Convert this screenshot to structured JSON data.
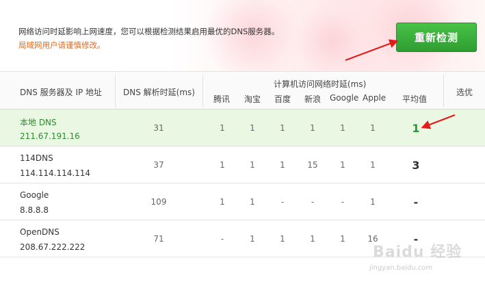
{
  "notice": {
    "text": "网络访问时延影响上网速度，您可以根据检测结果启用最优的DNS服务器。",
    "warning": "局域网用户请谨慎修改。"
  },
  "recheck_button": "重新检测",
  "table": {
    "col_server": "DNS 服务器及 IP 地址",
    "col_resolve": "DNS 解析时延(ms)",
    "col_group": "计算机访问网络时延(ms)",
    "sites": [
      "腾讯",
      "淘宝",
      "百度",
      "新浪",
      "Google",
      "Apple"
    ],
    "col_avg": "平均值",
    "col_choose": "选优",
    "rows": [
      {
        "name": "本地 DNS",
        "ip": "211.67.191.16",
        "resolve": "31",
        "sites": [
          "1",
          "1",
          "1",
          "1",
          "1",
          "1"
        ],
        "avg": "1"
      },
      {
        "name": "114DNS",
        "ip": "114.114.114.114",
        "resolve": "37",
        "sites": [
          "1",
          "1",
          "1",
          "15",
          "1",
          "1"
        ],
        "avg": "3"
      },
      {
        "name": "Google",
        "ip": "8.8.8.8",
        "resolve": "109",
        "sites": [
          "1",
          "1",
          "-",
          "-",
          "-",
          "1"
        ],
        "avg": "-"
      },
      {
        "name": "OpenDNS",
        "ip": "208.67.222.222",
        "resolve": "71",
        "sites": [
          "-",
          "1",
          "1",
          "1",
          "1",
          "16"
        ],
        "avg": "-"
      }
    ]
  },
  "watermark": {
    "brand": "Baidu 经验",
    "url": "jingyan.baidu.com"
  },
  "colors": {
    "button_green": "#3aae3a",
    "warning_orange": "#e26a1c",
    "highlight_row": "#e9f7e3",
    "annotation_red": "#e31b1b"
  }
}
